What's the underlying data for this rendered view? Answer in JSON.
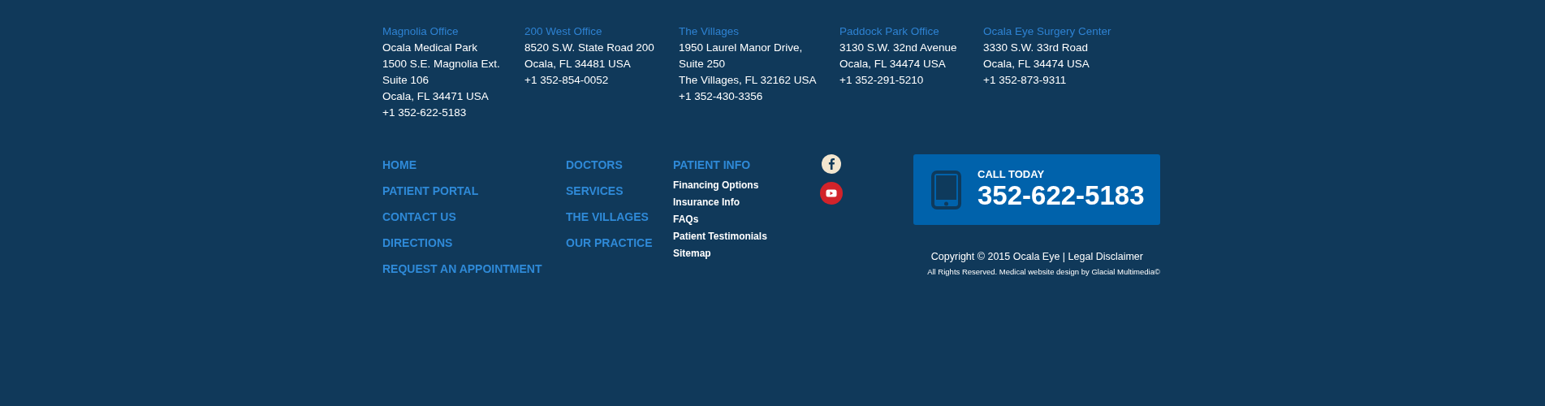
{
  "offices": [
    {
      "title": "Magnolia Office",
      "lines": [
        "Ocala Medical Park",
        "1500 S.E. Magnolia Ext.",
        "Suite 106",
        "Ocala, FL 34471 USA",
        "+1 352-622-5183"
      ]
    },
    {
      "title": "200 West Office",
      "lines": [
        "8520 S.W. State Road 200",
        "Ocala, FL 34481 USA",
        "+1 352-854-0052"
      ]
    },
    {
      "title": "The Villages",
      "lines": [
        "1950 Laurel Manor Drive,",
        "Suite 250",
        "The Villages, FL 32162 USA",
        "+1 352-430-3356"
      ]
    },
    {
      "title": "Paddock Park Office",
      "lines": [
        "3130 S.W. 32nd Avenue",
        "Ocala, FL 34474 USA",
        "+1 352-291-5210"
      ]
    },
    {
      "title": "Ocala Eye Surgery Center",
      "lines": [
        "3330 S.W. 33rd Road",
        "Ocala, FL 34474 USA",
        "+1 352-873-9311"
      ]
    }
  ],
  "nav_columns": [
    [
      "HOME",
      "PATIENT PORTAL",
      "CONTACT US",
      "DIRECTIONS",
      "REQUEST AN APPOINTMENT"
    ],
    [
      "DOCTORS",
      "SERVICES",
      "THE VILLAGES",
      "OUR PRACTICE"
    ]
  ],
  "patient_info": {
    "heading": "PATIENT INFO",
    "links": [
      "Financing Options",
      "Insurance Info",
      "FAQs",
      "Patient Testimonials",
      "Sitemap"
    ]
  },
  "social": [
    {
      "kind": "facebook"
    },
    {
      "kind": "youtube"
    }
  ],
  "call_box": {
    "label": "CALL TODAY",
    "phone": "352-622-5183"
  },
  "copyright": {
    "text": "Copyright © 2015 Ocala Eye |",
    "link": "Legal Disclaimer"
  },
  "credits": "All Rights Reserved. Medical website design by Glacial Multimedia©"
}
